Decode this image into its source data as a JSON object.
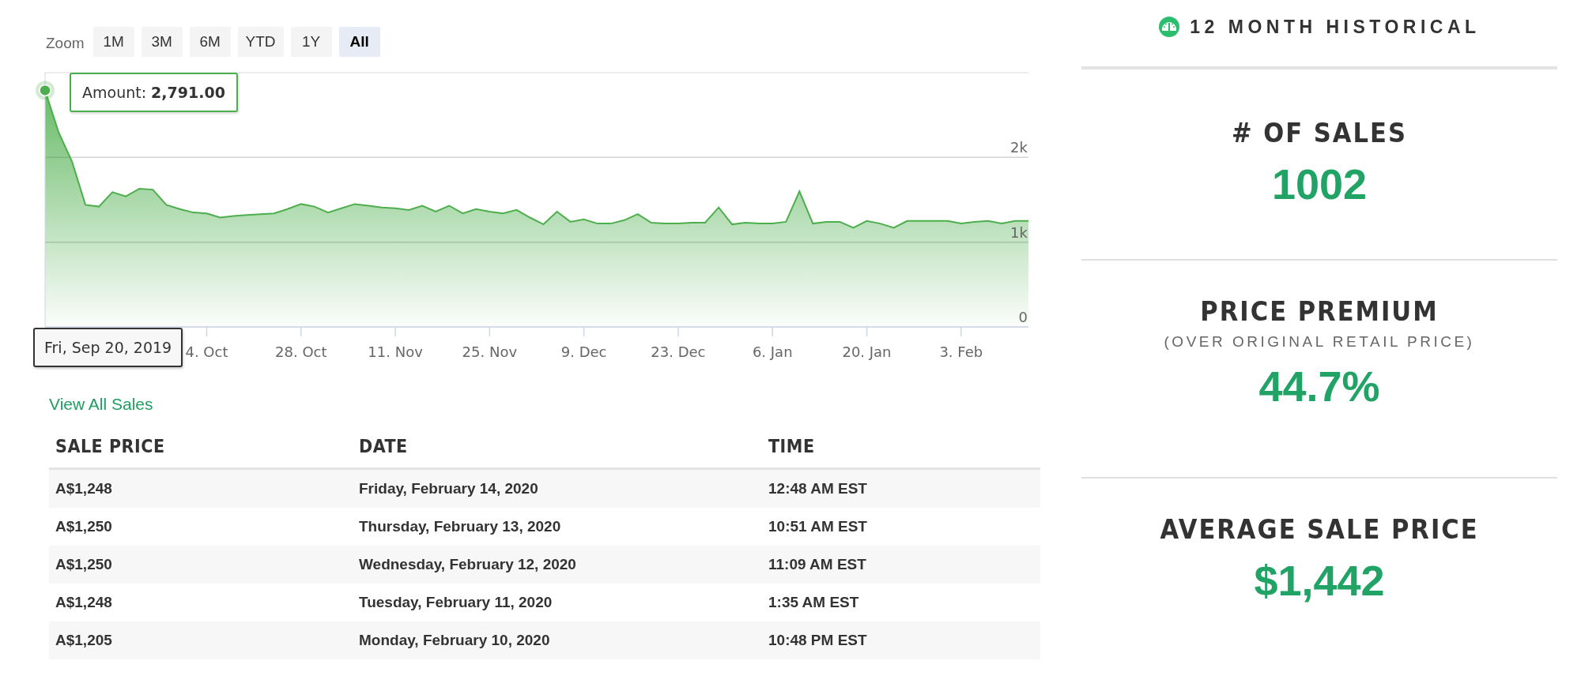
{
  "zoom": {
    "label": "Zoom",
    "buttons": [
      {
        "label": "1M",
        "selected": false
      },
      {
        "label": "3M",
        "selected": false
      },
      {
        "label": "6M",
        "selected": false
      },
      {
        "label": "YTD",
        "selected": false
      },
      {
        "label": "1Y",
        "selected": false
      },
      {
        "label": "All",
        "selected": true
      }
    ]
  },
  "chart": {
    "tooltip_value": "2,791.00",
    "date_label": "Fri, Sep 20, 2019",
    "chart_data": {
      "type": "area",
      "categories": [
        null,
        null,
        null,
        null,
        null,
        null,
        null,
        null,
        null,
        null,
        null,
        null,
        "4. Oct",
        null,
        null,
        null,
        null,
        null,
        null,
        "28. Oct",
        null,
        null,
        null,
        null,
        null,
        null,
        "11. Nov",
        null,
        null,
        null,
        null,
        null,
        null,
        "25. Nov",
        null,
        null,
        null,
        null,
        null,
        null,
        "9. Dec",
        null,
        null,
        null,
        null,
        null,
        null,
        "23. Dec",
        null,
        null,
        null,
        null,
        null,
        null,
        "6. Jan",
        null,
        null,
        null,
        null,
        null,
        null,
        "20. Jan",
        null,
        null,
        null,
        null,
        null,
        null,
        "3. Feb",
        null,
        null,
        null,
        null,
        null
      ],
      "series": [
        {
          "name": "Amount:",
          "color": "#4cae4c",
          "values": [
            2791,
            2300,
            1950,
            1440,
            1420,
            1590,
            1540,
            1630,
            1620,
            1440,
            1390,
            1350,
            1340,
            1290,
            1310,
            1320,
            1330,
            1340,
            1390,
            1450,
            1420,
            1350,
            1400,
            1450,
            1430,
            1410,
            1400,
            1380,
            1430,
            1360,
            1430,
            1340,
            1390,
            1360,
            1340,
            1380,
            1290,
            1210,
            1360,
            1240,
            1270,
            1220,
            1220,
            1260,
            1330,
            1230,
            1220,
            1220,
            1230,
            1230,
            1410,
            1210,
            1230,
            1220,
            1220,
            1240,
            1600,
            1220,
            1240,
            1240,
            1170,
            1250,
            1220,
            1170,
            1250,
            1250,
            1250,
            1250,
            1220,
            1240,
            1250,
            1220,
            1250,
            1250
          ]
        }
      ],
      "ylim": [
        0,
        3000
      ],
      "grid": true,
      "yticks": [
        {
          "value": 0,
          "label": "0"
        },
        {
          "value": 1000,
          "label": "1k"
        },
        {
          "value": 2000,
          "label": "2k"
        }
      ]
    }
  },
  "view_all_link": "View All Sales",
  "sales_table": {
    "columns": [
      "SALE PRICE",
      "DATE",
      "TIME"
    ],
    "rows": [
      [
        "A$1,248",
        "Friday, February 14, 2020",
        "12:48 AM EST"
      ],
      [
        "A$1,250",
        "Thursday, February 13, 2020",
        "10:51 AM EST"
      ],
      [
        "A$1,250",
        "Wednesday, February 12, 2020",
        "11:09 AM EST"
      ],
      [
        "A$1,248",
        "Tuesday, February 11, 2020",
        "1:35 AM EST"
      ],
      [
        "A$1,205",
        "Monday, February 10, 2020",
        "10:48 PM EST"
      ]
    ]
  },
  "historical": {
    "title": "12 MONTH HISTORICAL",
    "stats": [
      {
        "label": "# OF SALES",
        "value": "1002"
      },
      {
        "label": "PRICE PREMIUM",
        "sublabel": "(OVER ORIGINAL RETAIL PRICE)",
        "value": "44.7%"
      },
      {
        "label": "AVERAGE SALE PRICE",
        "value": "$1,442"
      }
    ]
  }
}
